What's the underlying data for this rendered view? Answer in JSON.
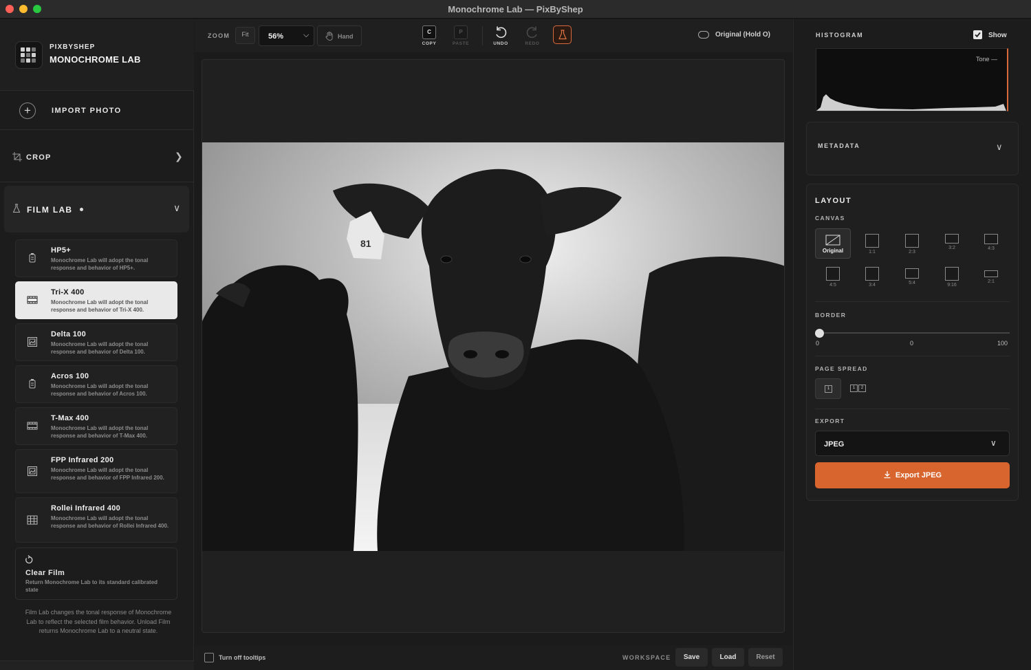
{
  "window": {
    "title": "Monochrome Lab — PixByShep"
  },
  "brand": {
    "small": "PIXBYSHEP",
    "name": "MONOCHROME LAB"
  },
  "sidebar": {
    "import_label": "IMPORT PHOTO",
    "crop_label": "CROP",
    "film_lab_label": "FILM LAB",
    "films": [
      {
        "name": "HP5+",
        "desc": "Monochrome Lab will adopt the tonal response and behavior of HP5+.",
        "icon": "film-canister-icon",
        "selected": false
      },
      {
        "name": "Tri-X 400",
        "desc": "Monochrome Lab will adopt the tonal response and behavior of Tri-X 400.",
        "icon": "film-strip-icon",
        "selected": true
      },
      {
        "name": "Delta 100",
        "desc": "Monochrome Lab will adopt the tonal response and behavior of Delta 100.",
        "icon": "image-frame-icon",
        "selected": false
      },
      {
        "name": "Acros 100",
        "desc": "Monochrome Lab will adopt the tonal response and behavior of Acros 100.",
        "icon": "film-canister-icon",
        "selected": false
      },
      {
        "name": "T-Max 400",
        "desc": "Monochrome Lab will adopt the tonal response and behavior of T-Max 400.",
        "icon": "film-strip-icon",
        "selected": false
      },
      {
        "name": "FPP Infrared 200",
        "desc": "Monochrome Lab will adopt the tonal response and behavior of FPP Infrared 200.",
        "icon": "image-frame-icon",
        "selected": false
      },
      {
        "name": "Rollei Infrared 400",
        "desc": "Monochrome Lab will adopt the tonal response and behavior of Rollei Infrared 400.",
        "icon": "film-grid-icon",
        "selected": false
      }
    ],
    "clear_film": {
      "name": "Clear Film",
      "desc": "Return Monochrome Lab to its standard calibrated state"
    },
    "footnote": "Film Lab changes the tonal response of Monochrome Lab to reflect the selected film behavior. Unload Film returns Monochrome Lab to a neutral state."
  },
  "toolbar": {
    "zoom_label": "ZOOM",
    "fit_label": "Fit",
    "zoom_value": "56%",
    "hand_label": "Hand",
    "copy_key": "C",
    "copy_label": "COPY",
    "paste_key": "P",
    "paste_label": "PASTE",
    "undo_label": "UNDO",
    "redo_label": "REDO",
    "original_label": "Original (Hold O)"
  },
  "bottom": {
    "tooltips_label": "Turn off tooltips",
    "workspace_label": "WORKSPACE",
    "save_label": "Save",
    "load_label": "Load",
    "reset_label": "Reset"
  },
  "right": {
    "histogram_title": "HISTOGRAM",
    "show_label": "Show",
    "tone_label": "Tone —",
    "metadata_title": "METADATA",
    "layout_title": "LAYOUT",
    "canvas_title": "CANVAS",
    "ratios": [
      "Original",
      "1:1",
      "2:3",
      "3:2",
      "4:3",
      "4:5",
      "3:4",
      "5:4",
      "9:16",
      "2:1"
    ],
    "border_title": "BORDER",
    "border_min": "0",
    "border_value": "0",
    "border_max": "100",
    "page_spread_title": "PAGE SPREAD",
    "spread_single": "1",
    "spread_left": "1",
    "spread_right": "2",
    "export_title": "EXPORT",
    "export_format": "JPEG",
    "export_button": "Export JPEG",
    "accent": "#d9652e"
  }
}
